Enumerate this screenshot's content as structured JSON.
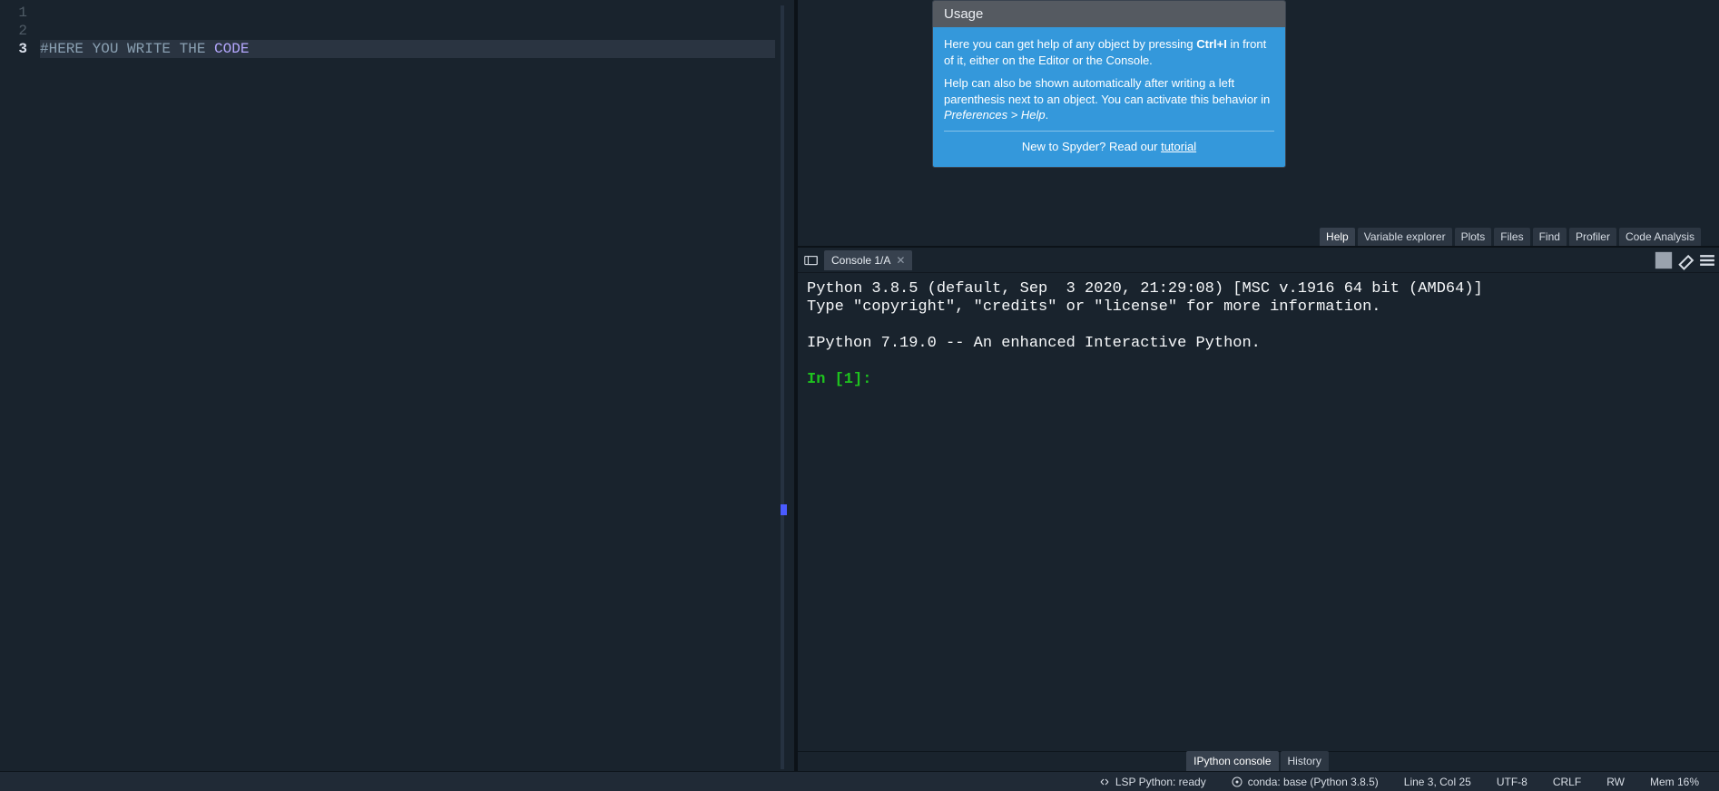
{
  "editor": {
    "lines": [
      "1",
      "2",
      "3"
    ],
    "current_line_index": 2,
    "comment_prefix": "#HERE YOU WRITE THE ",
    "highlighted_word": "CODE"
  },
  "help": {
    "usage_title": "Usage",
    "para1_pre": "Here you can get help of any object by pressing ",
    "para1_kbd": "Ctrl+I",
    "para1_post": " in front of it, either on the Editor or the Console.",
    "para2_pre": "Help can also be shown automatically after writing a left parenthesis next to an object. You can activate this behavior in ",
    "para2_pref": "Preferences > Help",
    "para2_post": ".",
    "footer_pre": "New to Spyder? Read our ",
    "footer_link": "tutorial",
    "tabs": [
      "Help",
      "Variable explorer",
      "Plots",
      "Files",
      "Find",
      "Profiler",
      "Code Analysis"
    ],
    "active_tab": 0
  },
  "console": {
    "tab_label": "Console 1/A",
    "banner_line1": "Python 3.8.5 (default, Sep  3 2020, 21:29:08) [MSC v.1916 64 bit (AMD64)]",
    "banner_line2": "Type \"copyright\", \"credits\" or \"license\" for more information.",
    "banner_line3": "IPython 7.19.0 -- An enhanced Interactive Python.",
    "prompt": "In [1]:",
    "bottom_tabs": [
      "IPython console",
      "History"
    ],
    "active_bottom_tab": 0
  },
  "status": {
    "lsp": "LSP Python: ready",
    "conda": "conda: base (Python 3.8.5)",
    "pos": "Line 3, Col 25",
    "enc": "UTF-8",
    "eol": "CRLF",
    "rw": "RW",
    "mem": "Mem 16%"
  }
}
